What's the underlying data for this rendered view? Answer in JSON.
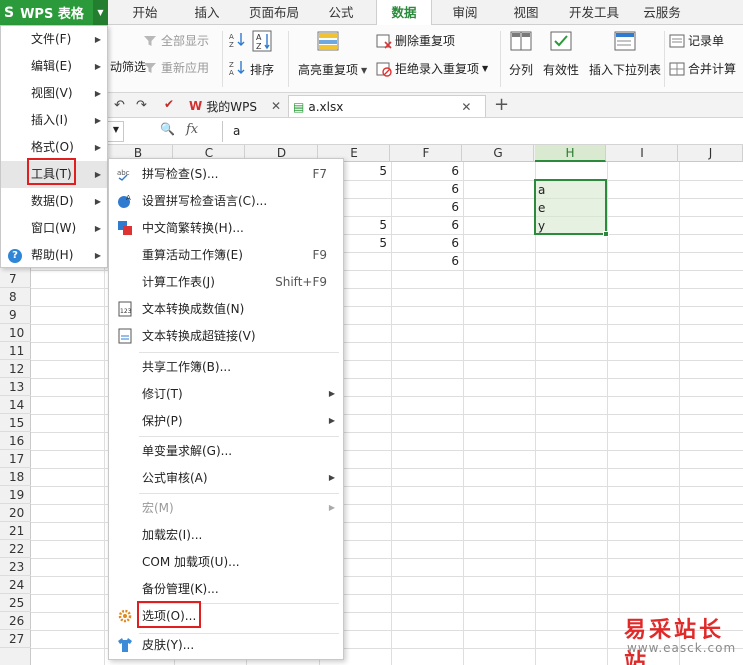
{
  "app": {
    "title": "WPS 表格"
  },
  "ribbon_tabs": [
    "开始",
    "插入",
    "页面布局",
    "公式",
    "数据",
    "审阅",
    "视图",
    "开发工具",
    "云服务"
  ],
  "ribbon": {
    "show_all": "全部显示",
    "reapply": "重新应用",
    "auto_filter_partial": "动筛选",
    "sort": "排序",
    "highlight_dup": "高亮重复项",
    "remove_dup": "删除重复项",
    "reject_dup": "拒绝录入重复项",
    "split_column": "分列",
    "validity": "有效性",
    "insert_dropdown": "插入下拉列表",
    "record_form": "记录单",
    "consolidate": "合并计算"
  },
  "doc_tabs": [
    {
      "label": "我的WPS"
    },
    {
      "label": "a.xlsx"
    }
  ],
  "formula_bar": {
    "fx": "fx",
    "value": "a"
  },
  "columns": [
    "B",
    "C",
    "D",
    "E",
    "F",
    "G",
    "H",
    "I",
    "J"
  ],
  "rows": [
    "7",
    "8",
    "9",
    "10",
    "11",
    "12",
    "13",
    "14",
    "15",
    "16",
    "17",
    "18",
    "19",
    "20",
    "21",
    "22",
    "23",
    "24",
    "25",
    "26",
    "27"
  ],
  "cells": {
    "E1": "5",
    "F1": "6",
    "F2": "6",
    "F3": "6",
    "E4": "5",
    "F4": "6",
    "E5": "5",
    "F5": "6",
    "F6": "6",
    "H2": "a",
    "H3": "e",
    "H4": "y"
  },
  "main_menu": [
    {
      "label": "文件(F)"
    },
    {
      "label": "编辑(E)"
    },
    {
      "label": "视图(V)"
    },
    {
      "label": "插入(I)"
    },
    {
      "label": "格式(O)"
    },
    {
      "label": "工具(T)"
    },
    {
      "label": "数据(D)"
    },
    {
      "label": "窗口(W)"
    },
    {
      "label": "帮助(H)"
    }
  ],
  "tools_menu": [
    {
      "label": "拼写检查(S)...",
      "shortcut": "F7"
    },
    {
      "label": "设置拼写检查语言(C)..."
    },
    {
      "label": "中文简繁转换(H)..."
    },
    {
      "label": "重算活动工作簿(E)",
      "shortcut": "F9"
    },
    {
      "label": "计算工作表(J)",
      "shortcut": "Shift+F9"
    },
    {
      "label": "文本转换成数值(N)"
    },
    {
      "label": "文本转换成超链接(V)"
    },
    {
      "label": "共享工作簿(B)..."
    },
    {
      "label": "修订(T)"
    },
    {
      "label": "保护(P)"
    },
    {
      "label": "单变量求解(G)..."
    },
    {
      "label": "公式审核(A)"
    },
    {
      "label": "宏(M)"
    },
    {
      "label": "加载宏(I)..."
    },
    {
      "label": "COM 加载项(U)..."
    },
    {
      "label": "备份管理(K)..."
    },
    {
      "label": "选项(O)..."
    },
    {
      "label": "皮肤(Y)..."
    }
  ],
  "watermark": {
    "title": "易采站长站",
    "url": "www.easck.com"
  },
  "colors": {
    "accent": "#2b9a3a",
    "highlight_box": "#e02020",
    "selection": "#2b8a3b"
  }
}
